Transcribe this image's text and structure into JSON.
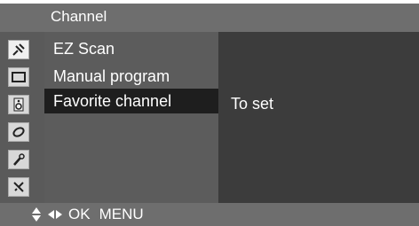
{
  "window": {
    "title": "Channel"
  },
  "sidebar": {
    "icons": [
      {
        "name": "antenna-icon",
        "selected": true
      },
      {
        "name": "screen-icon",
        "selected": false
      },
      {
        "name": "sound-icon",
        "selected": false
      },
      {
        "name": "time-icon",
        "selected": false
      },
      {
        "name": "lock-key-icon",
        "selected": false
      },
      {
        "name": "setup-icon",
        "selected": false
      }
    ]
  },
  "menu": {
    "items": [
      {
        "label": "EZ Scan"
      },
      {
        "label": "Manual program"
      },
      {
        "label": "Favorite channel",
        "active": true
      }
    ]
  },
  "submenu": {
    "value": "To set"
  },
  "footer": {
    "ok_label": "OK",
    "menu_label": "MENU"
  },
  "colors": {
    "titlebar": "#6e6e6e",
    "menu_bg": "#5c5c5c",
    "active_row": "#1e1e1e",
    "submenu_bg": "#3c3c3c"
  }
}
